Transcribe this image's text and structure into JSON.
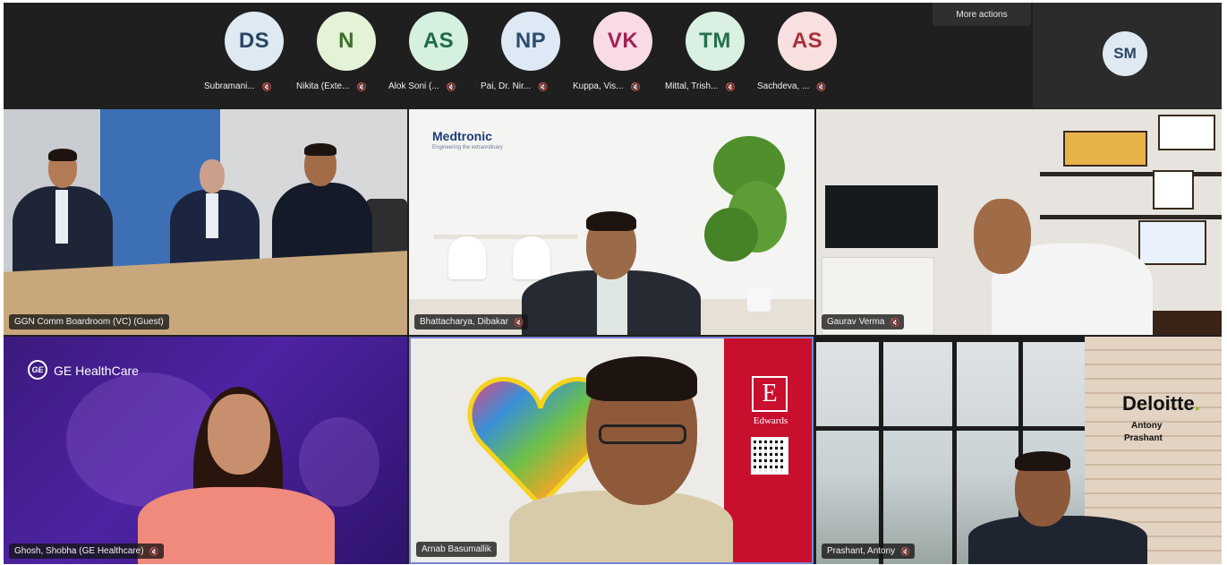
{
  "top_strip": {
    "participants": [
      {
        "initials": "DS",
        "name": "Subramani...",
        "bg": "#dfe9f2",
        "fg": "#2a4661"
      },
      {
        "initials": "N",
        "name": "Nikita (Exte...",
        "bg": "#e4f2d8",
        "fg": "#3b6e2b"
      },
      {
        "initials": "AS",
        "name": "Alok Soni (...",
        "bg": "#d6f0e0",
        "fg": "#1e6b44"
      },
      {
        "initials": "NP",
        "name": "Pai, Dr. Nir...",
        "bg": "#dde9f4",
        "fg": "#2a4d6e"
      },
      {
        "initials": "VK",
        "name": "Kuppa, Vis...",
        "bg": "#f8dbe6",
        "fg": "#a3214f"
      },
      {
        "initials": "TM",
        "name": "Mittal, Trish...",
        "bg": "#d9f0e3",
        "fg": "#25704a"
      },
      {
        "initials": "AS",
        "name": "Sachdeva, ...",
        "bg": "#f9e0e0",
        "fg": "#a8303a"
      }
    ],
    "more_actions_label": "More actions",
    "self_initials": "SM"
  },
  "video_tiles": [
    {
      "label": "GGN Comm Boardroom (VC) (Guest)"
    },
    {
      "label": "Bhattacharya, Dibakar",
      "brand": "Medtronic",
      "brand_tagline": "Engineering the extraordinary"
    },
    {
      "label": "Gaurav Verma"
    },
    {
      "label": "Ghosh, Shobha (GE Healthcare)",
      "brand": "GE HealthCare"
    },
    {
      "label": "Arnab Basumallik",
      "brand": "Edwards"
    },
    {
      "label": "Prashant, Antony",
      "brand": "Deloitte",
      "brand_line1": "Antony",
      "brand_line2": "Prashant"
    }
  ],
  "colors": {
    "strip_bg": "#1f1f1f",
    "active_speaker_outline": "#7a82d6",
    "edwards_red": "#c8102e",
    "ge_purple": "#4d23a3"
  },
  "icons": {
    "mic_off": "mic-off-icon"
  }
}
